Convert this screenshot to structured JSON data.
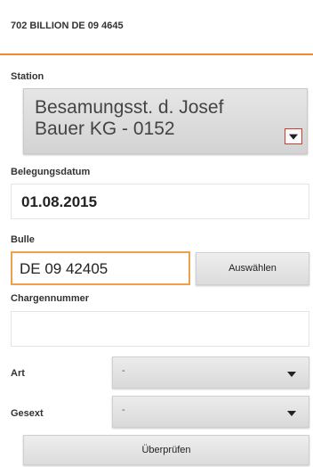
{
  "header": {
    "title": "702  BILLION  DE 09 4645"
  },
  "station": {
    "label": "Station",
    "value_line1": "Besamungsst. d. Josef",
    "value_line2": "Bauer KG - 0152"
  },
  "belegungsdatum": {
    "label": "Belegungsdatum",
    "value": "01.08.2015"
  },
  "bulle": {
    "label": "Bulle",
    "value": "DE 09 42405",
    "select_button": "Auswählen"
  },
  "chargennummer": {
    "label": "Chargennummer",
    "value": ""
  },
  "art": {
    "label": "Art",
    "value": "-"
  },
  "gesext": {
    "label": "Gesext",
    "value": "-"
  },
  "check_button": "Überprüfen",
  "colors": {
    "accent": "#ef8a2e",
    "input_focus": "#f0a04a",
    "dropdown_border": "#d8392e"
  }
}
